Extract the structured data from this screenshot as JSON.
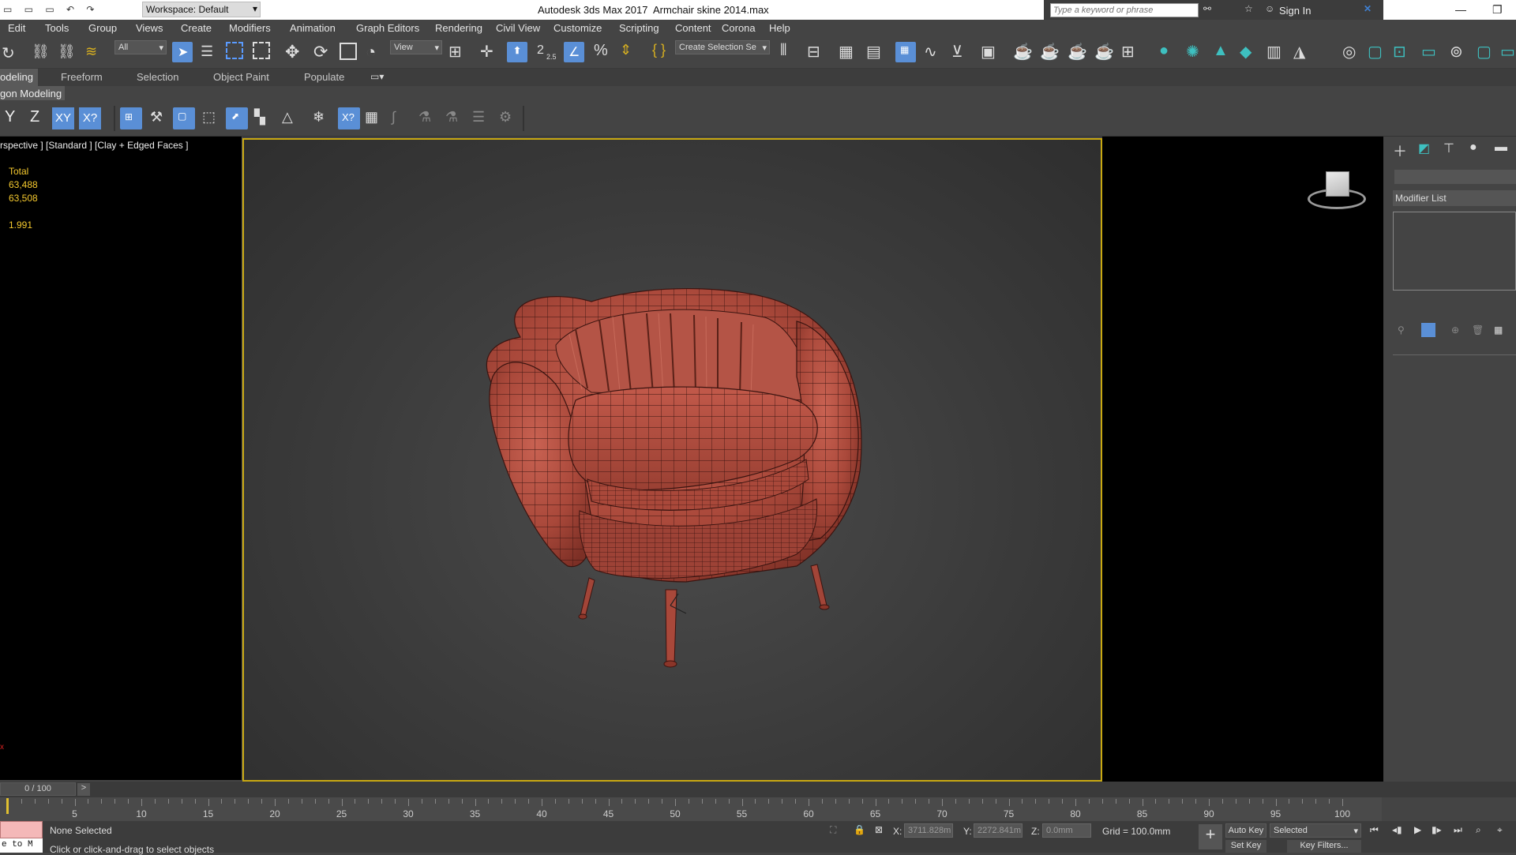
{
  "titlebar": {
    "app": "Autodesk 3ds Max 2017",
    "file": "Armchair skine 2014.max",
    "workspace": "Workspace: Default",
    "search_placeholder": "Type a keyword or phrase",
    "sign_in": "Sign In"
  },
  "menu": [
    "Edit",
    "Tools",
    "Group",
    "Views",
    "Create",
    "Modifiers",
    "Animation",
    "Graph Editors",
    "Rendering",
    "Civil View",
    "Customize",
    "Scripting",
    "Content",
    "Corona",
    "Help"
  ],
  "toolbar": {
    "filter": "All",
    "coord": "View",
    "selection_set": "Create Selection Se",
    "snap_angle": "2.5"
  },
  "ribbon": {
    "tabs": [
      "odeling",
      "Freeform",
      "Selection",
      "Object Paint",
      "Populate"
    ],
    "title": "gon Modeling"
  },
  "axis": {
    "y": "Y",
    "z": "Z",
    "xy": "XY",
    "xyz": "X?"
  },
  "viewport": {
    "label": "rspective ] [Standard ] [Clay + Edged Faces ]",
    "stats": {
      "total": "Total",
      "polys": "63,488",
      "verts": "63,508",
      "fps": "1.991"
    }
  },
  "cmd": {
    "modifier_list": "Modifier List"
  },
  "time": {
    "frame": "0 / 100",
    "ticks": [
      5,
      10,
      15,
      20,
      25,
      30,
      35,
      40,
      45,
      50,
      55,
      60,
      65,
      70,
      75,
      80,
      85,
      90,
      95,
      100
    ]
  },
  "status": {
    "selection": "None Selected",
    "prompt": "Click or click-and-drag to select objects",
    "x_label": "X:",
    "x_value": "3711.828m",
    "y_label": "Y:",
    "y_value": "2272.841m",
    "z_label": "Z:",
    "z_value": "0.0mm",
    "grid": "Grid = 100.0mm",
    "auto_key": "Auto Key",
    "selected": "Selected",
    "set_key": "Set Key",
    "key_filters": "Key Filters...",
    "mini": "e to M"
  }
}
